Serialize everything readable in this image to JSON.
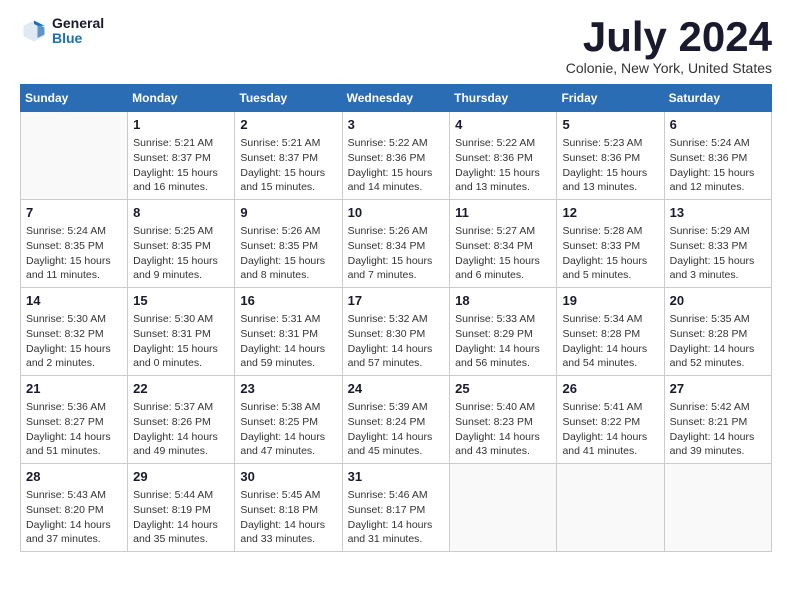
{
  "logo": {
    "general": "General",
    "blue": "Blue"
  },
  "header": {
    "month_title": "July 2024",
    "location": "Colonie, New York, United States"
  },
  "days_of_week": [
    "Sunday",
    "Monday",
    "Tuesday",
    "Wednesday",
    "Thursday",
    "Friday",
    "Saturday"
  ],
  "weeks": [
    [
      {
        "day": null,
        "info": null
      },
      {
        "day": "1",
        "info": "Sunrise: 5:21 AM\nSunset: 8:37 PM\nDaylight: 15 hours\nand 16 minutes."
      },
      {
        "day": "2",
        "info": "Sunrise: 5:21 AM\nSunset: 8:37 PM\nDaylight: 15 hours\nand 15 minutes."
      },
      {
        "day": "3",
        "info": "Sunrise: 5:22 AM\nSunset: 8:36 PM\nDaylight: 15 hours\nand 14 minutes."
      },
      {
        "day": "4",
        "info": "Sunrise: 5:22 AM\nSunset: 8:36 PM\nDaylight: 15 hours\nand 13 minutes."
      },
      {
        "day": "5",
        "info": "Sunrise: 5:23 AM\nSunset: 8:36 PM\nDaylight: 15 hours\nand 13 minutes."
      },
      {
        "day": "6",
        "info": "Sunrise: 5:24 AM\nSunset: 8:36 PM\nDaylight: 15 hours\nand 12 minutes."
      }
    ],
    [
      {
        "day": "7",
        "info": "Sunrise: 5:24 AM\nSunset: 8:35 PM\nDaylight: 15 hours\nand 11 minutes."
      },
      {
        "day": "8",
        "info": "Sunrise: 5:25 AM\nSunset: 8:35 PM\nDaylight: 15 hours\nand 9 minutes."
      },
      {
        "day": "9",
        "info": "Sunrise: 5:26 AM\nSunset: 8:35 PM\nDaylight: 15 hours\nand 8 minutes."
      },
      {
        "day": "10",
        "info": "Sunrise: 5:26 AM\nSunset: 8:34 PM\nDaylight: 15 hours\nand 7 minutes."
      },
      {
        "day": "11",
        "info": "Sunrise: 5:27 AM\nSunset: 8:34 PM\nDaylight: 15 hours\nand 6 minutes."
      },
      {
        "day": "12",
        "info": "Sunrise: 5:28 AM\nSunset: 8:33 PM\nDaylight: 15 hours\nand 5 minutes."
      },
      {
        "day": "13",
        "info": "Sunrise: 5:29 AM\nSunset: 8:33 PM\nDaylight: 15 hours\nand 3 minutes."
      }
    ],
    [
      {
        "day": "14",
        "info": "Sunrise: 5:30 AM\nSunset: 8:32 PM\nDaylight: 15 hours\nand 2 minutes."
      },
      {
        "day": "15",
        "info": "Sunrise: 5:30 AM\nSunset: 8:31 PM\nDaylight: 15 hours\nand 0 minutes."
      },
      {
        "day": "16",
        "info": "Sunrise: 5:31 AM\nSunset: 8:31 PM\nDaylight: 14 hours\nand 59 minutes."
      },
      {
        "day": "17",
        "info": "Sunrise: 5:32 AM\nSunset: 8:30 PM\nDaylight: 14 hours\nand 57 minutes."
      },
      {
        "day": "18",
        "info": "Sunrise: 5:33 AM\nSunset: 8:29 PM\nDaylight: 14 hours\nand 56 minutes."
      },
      {
        "day": "19",
        "info": "Sunrise: 5:34 AM\nSunset: 8:28 PM\nDaylight: 14 hours\nand 54 minutes."
      },
      {
        "day": "20",
        "info": "Sunrise: 5:35 AM\nSunset: 8:28 PM\nDaylight: 14 hours\nand 52 minutes."
      }
    ],
    [
      {
        "day": "21",
        "info": "Sunrise: 5:36 AM\nSunset: 8:27 PM\nDaylight: 14 hours\nand 51 minutes."
      },
      {
        "day": "22",
        "info": "Sunrise: 5:37 AM\nSunset: 8:26 PM\nDaylight: 14 hours\nand 49 minutes."
      },
      {
        "day": "23",
        "info": "Sunrise: 5:38 AM\nSunset: 8:25 PM\nDaylight: 14 hours\nand 47 minutes."
      },
      {
        "day": "24",
        "info": "Sunrise: 5:39 AM\nSunset: 8:24 PM\nDaylight: 14 hours\nand 45 minutes."
      },
      {
        "day": "25",
        "info": "Sunrise: 5:40 AM\nSunset: 8:23 PM\nDaylight: 14 hours\nand 43 minutes."
      },
      {
        "day": "26",
        "info": "Sunrise: 5:41 AM\nSunset: 8:22 PM\nDaylight: 14 hours\nand 41 minutes."
      },
      {
        "day": "27",
        "info": "Sunrise: 5:42 AM\nSunset: 8:21 PM\nDaylight: 14 hours\nand 39 minutes."
      }
    ],
    [
      {
        "day": "28",
        "info": "Sunrise: 5:43 AM\nSunset: 8:20 PM\nDaylight: 14 hours\nand 37 minutes."
      },
      {
        "day": "29",
        "info": "Sunrise: 5:44 AM\nSunset: 8:19 PM\nDaylight: 14 hours\nand 35 minutes."
      },
      {
        "day": "30",
        "info": "Sunrise: 5:45 AM\nSunset: 8:18 PM\nDaylight: 14 hours\nand 33 minutes."
      },
      {
        "day": "31",
        "info": "Sunrise: 5:46 AM\nSunset: 8:17 PM\nDaylight: 14 hours\nand 31 minutes."
      },
      {
        "day": null,
        "info": null
      },
      {
        "day": null,
        "info": null
      },
      {
        "day": null,
        "info": null
      }
    ]
  ]
}
